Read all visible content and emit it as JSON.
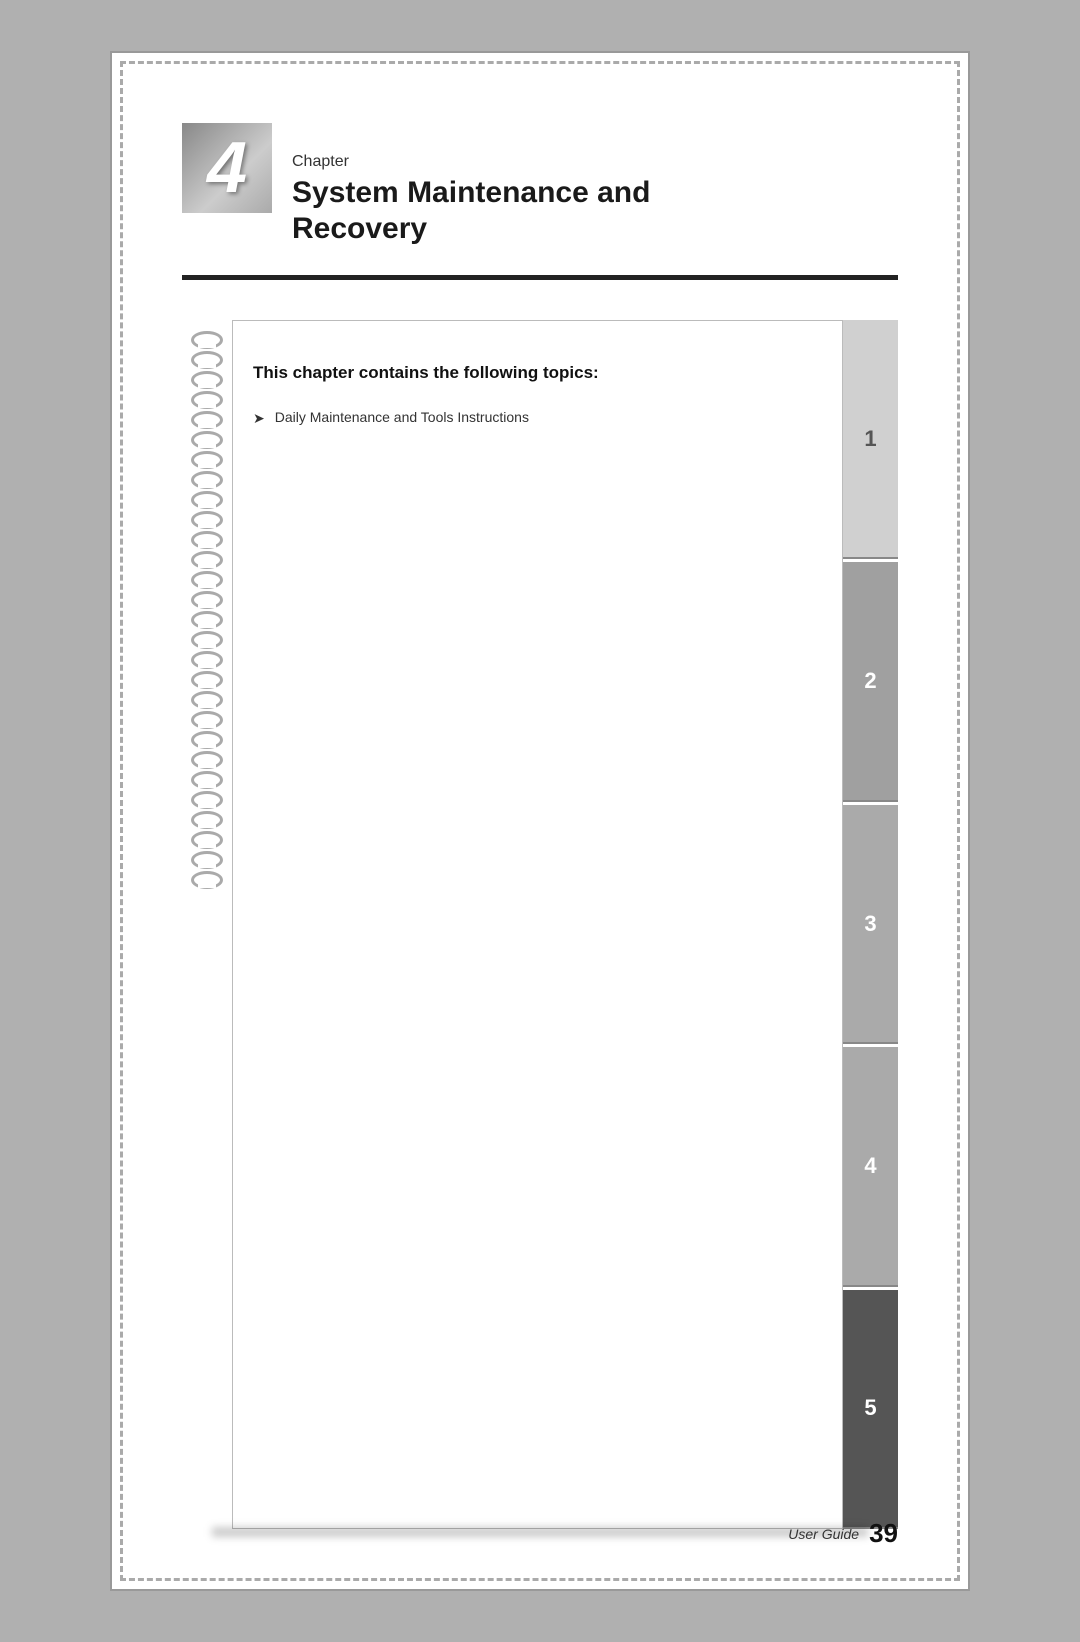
{
  "page": {
    "background_color": "#b0b0b0"
  },
  "chapter": {
    "number": "4",
    "label": "Chapter",
    "title_line1": "System Maintenance and",
    "title_line2": "Recovery"
  },
  "notebook": {
    "intro_text": "This chapter contains the following topics:",
    "topics": [
      {
        "text": "Daily Maintenance and Tools Instructions"
      }
    ]
  },
  "tabs": [
    {
      "label": "1",
      "active": false
    },
    {
      "label": "2",
      "active": false
    },
    {
      "label": "3",
      "active": false
    },
    {
      "label": "4",
      "active": false
    },
    {
      "label": "5",
      "active": true
    }
  ],
  "footer": {
    "label": "User Guide",
    "page_number": "39"
  },
  "spiral_count": 28
}
